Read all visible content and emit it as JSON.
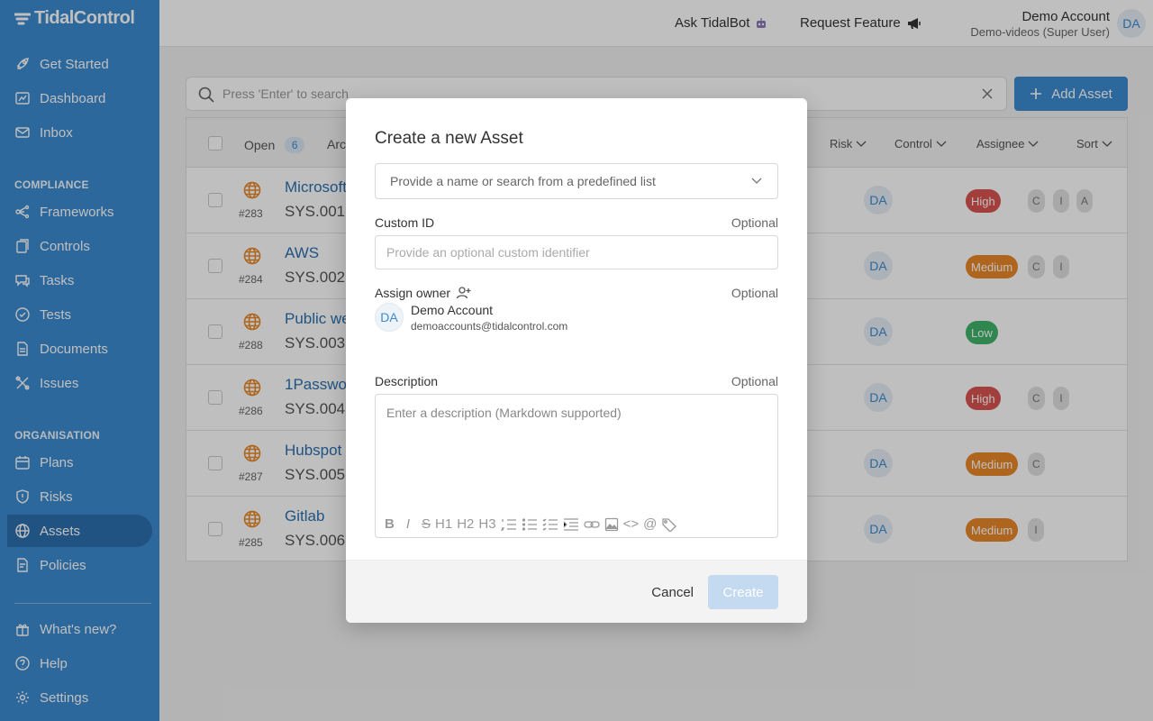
{
  "brand": {
    "name": "TidalControl",
    "accent": "#3b8bd0"
  },
  "sidebar": {
    "top_items": [
      {
        "label": "Get Started",
        "icon": "rocket-icon"
      },
      {
        "label": "Dashboard",
        "icon": "chart-icon"
      },
      {
        "label": "Inbox",
        "icon": "mail-icon"
      }
    ],
    "compliance_label": "COMPLIANCE",
    "compliance_items": [
      {
        "label": "Frameworks",
        "icon": "framework-icon"
      },
      {
        "label": "Controls",
        "icon": "controls-icon"
      },
      {
        "label": "Tasks",
        "icon": "tasks-icon"
      },
      {
        "label": "Tests",
        "icon": "check-circle-icon"
      },
      {
        "label": "Documents",
        "icon": "document-icon"
      },
      {
        "label": "Issues",
        "icon": "issues-icon"
      }
    ],
    "organisation_label": "ORGANISATION",
    "organisation_items": [
      {
        "label": "Plans",
        "icon": "calendar-icon"
      },
      {
        "label": "Risks",
        "icon": "shield-icon"
      },
      {
        "label": "Assets",
        "icon": "globe-icon",
        "active": true
      },
      {
        "label": "Policies",
        "icon": "policy-icon"
      }
    ],
    "bottom_items": [
      {
        "label": "What's new?",
        "icon": "gift-icon"
      },
      {
        "label": "Help",
        "icon": "help-icon"
      },
      {
        "label": "Settings",
        "icon": "gear-icon"
      }
    ]
  },
  "header": {
    "ask_label": "Ask TidalBot",
    "request_label": "Request Feature",
    "user_name": "Demo Account",
    "user_role": "Demo-videos (Super User)",
    "avatar_initials": "DA"
  },
  "main": {
    "search_placeholder": "Press 'Enter' to search",
    "add_label": "Add Asset",
    "tabs": {
      "open_label": "Open",
      "open_count": "6",
      "archived_partial": "Arc"
    },
    "columns": {
      "risk": "Risk",
      "control": "Control",
      "assignee": "Assignee",
      "sort": "Sort"
    },
    "rows": [
      {
        "num": "#283",
        "name": "Microsoft",
        "sys": "SYS.001",
        "assignee": "DA",
        "risk": "High",
        "risk_level": "high",
        "cia": [
          "C",
          "I",
          "A"
        ]
      },
      {
        "num": "#284",
        "name": "AWS",
        "sys": "SYS.002",
        "assignee": "DA",
        "risk": "Medium",
        "risk_level": "medium",
        "cia": [
          "C",
          "I"
        ]
      },
      {
        "num": "#288",
        "name": "Public we",
        "sys": "SYS.003",
        "assignee": "DA",
        "risk": "Low",
        "risk_level": "low",
        "cia": []
      },
      {
        "num": "#286",
        "name": "1Passwor",
        "sys": "SYS.004",
        "assignee": "DA",
        "risk": "High",
        "risk_level": "high",
        "cia": [
          "C",
          "I"
        ]
      },
      {
        "num": "#287",
        "name": "Hubspot",
        "sys": "SYS.005",
        "assignee": "DA",
        "risk": "Medium",
        "risk_level": "medium",
        "cia": [
          "C"
        ]
      },
      {
        "num": "#285",
        "name": "Gitlab",
        "sys": "SYS.006",
        "assignee": "DA",
        "risk": "Medium",
        "risk_level": "medium",
        "cia": [
          "I"
        ]
      }
    ]
  },
  "modal": {
    "title": "Create a new Asset",
    "name_placeholder": "Provide a name or search from a predefined list",
    "custom_id_label": "Custom ID",
    "optional_label": "Optional",
    "custom_id_placeholder": "Provide an optional custom identifier",
    "owner_label": "Assign owner",
    "owner_initials": "DA",
    "owner_name": "Demo Account",
    "owner_email": "demoaccounts@tidalcontrol.com",
    "description_label": "Description",
    "description_placeholder": "Enter a description (Markdown supported)",
    "toolbar": {
      "bold": "B",
      "italic": "I",
      "strike": "S",
      "h1": "H1",
      "h2": "H2",
      "h3": "H3",
      "code": "<>",
      "mention": "@"
    },
    "cancel_label": "Cancel",
    "create_label": "Create"
  }
}
